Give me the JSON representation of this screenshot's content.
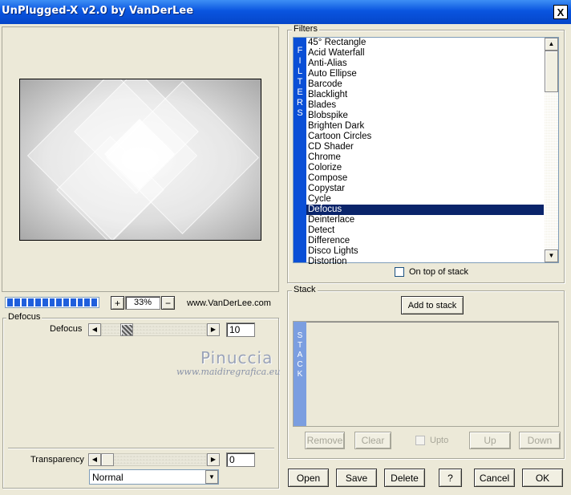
{
  "window": {
    "title": "UnPlugged-X v2.0 by VanDerLee",
    "close_label": "X"
  },
  "zoom": {
    "minus_label": "−",
    "plus_label": "+",
    "value": "33%",
    "progress_percent": 100
  },
  "website": "www.VanDerLee.com",
  "defocus_group": {
    "label": "Defocus",
    "slider_label": "Defocus",
    "value": "10"
  },
  "watermark": {
    "name": "Pinuccia",
    "url": "www.maidiregrafica.eu"
  },
  "transparency": {
    "label": "Transparency",
    "value": "0"
  },
  "blend_mode": {
    "selected": "Normal"
  },
  "filters": {
    "group_label": "Filters",
    "banner_text": "FILTERS",
    "items": [
      "45° Rectangle",
      "Acid Waterfall",
      "Anti-Alias",
      "Auto Ellipse",
      "Barcode",
      "Blacklight",
      "Blades",
      "Blobspike",
      "Brighten Dark",
      "Cartoon Circles",
      "CD Shader",
      "Chrome",
      "Colorize",
      "Compose",
      "Copystar",
      "Cycle",
      "Defocus",
      "Deinterlace",
      "Detect",
      "Difference",
      "Disco Lights",
      "Distortion"
    ],
    "selected": "Defocus",
    "on_top_label": "On top of stack"
  },
  "stack": {
    "group_label": "Stack",
    "add_label": "Add to stack",
    "banner_text": "STACK",
    "remove_label": "Remove",
    "clear_label": "Clear",
    "upto_label": "Upto",
    "up_label": "Up",
    "down_label": "Down"
  },
  "footer": {
    "open_label": "Open",
    "save_label": "Save",
    "delete_label": "Delete",
    "help_label": "?",
    "cancel_label": "Cancel",
    "ok_label": "OK"
  },
  "colors": {
    "titlebar": "#0a55e0",
    "selection": "#0a246a",
    "banner": "#0a4fd6"
  }
}
